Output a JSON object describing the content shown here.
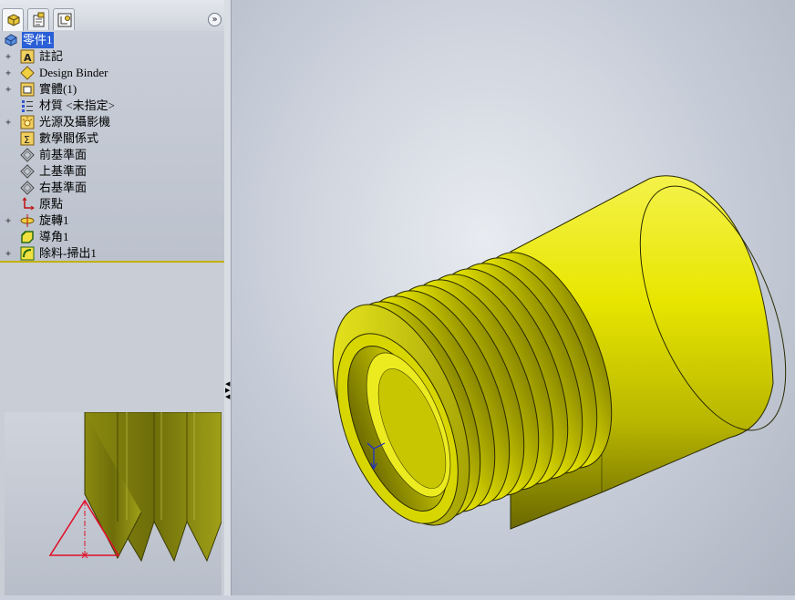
{
  "tabs": [
    {
      "name": "feature-manager",
      "active": true
    },
    {
      "name": "property-manager",
      "active": false
    },
    {
      "name": "configuration-manager",
      "active": false
    }
  ],
  "expand_symbol": "»",
  "tree": {
    "root": {
      "label": "零件1",
      "icon": "part-icon"
    },
    "items": [
      {
        "label": "註記",
        "icon": "annotation-icon",
        "expandable": true
      },
      {
        "label": "Design Binder",
        "icon": "design-binder-icon",
        "expandable": true
      },
      {
        "label": "實體(1)",
        "icon": "solid-bodies-icon",
        "expandable": true
      },
      {
        "label": "材質 <未指定>",
        "icon": "material-icon",
        "expandable": false
      },
      {
        "label": "光源及攝影機",
        "icon": "lights-camera-icon",
        "expandable": true
      },
      {
        "label": "數學關係式",
        "icon": "equations-icon",
        "expandable": false
      },
      {
        "label": "前基準面",
        "icon": "plane-icon",
        "expandable": false
      },
      {
        "label": "上基準面",
        "icon": "plane-icon",
        "expandable": false
      },
      {
        "label": "右基準面",
        "icon": "plane-icon",
        "expandable": false
      },
      {
        "label": "原點",
        "icon": "origin-icon",
        "expandable": false
      },
      {
        "label": "旋轉1",
        "icon": "revolve-icon",
        "expandable": true
      },
      {
        "label": "導角1",
        "icon": "chamfer-icon",
        "expandable": false
      },
      {
        "label": "除料-掃出1",
        "icon": "swept-cut-icon",
        "expandable": true
      }
    ]
  },
  "colors": {
    "part_yellow": "#e8e600",
    "part_shadow": "#7a7a00",
    "selection_blue": "#2a5fd6",
    "profile_red": "#e0102a"
  }
}
